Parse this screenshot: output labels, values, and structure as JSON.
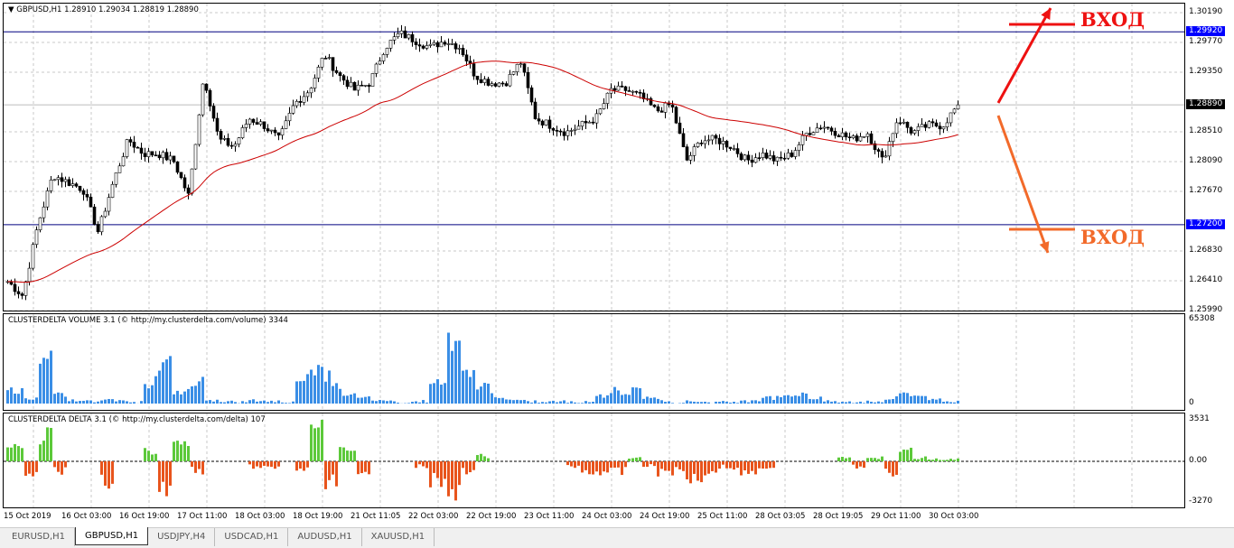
{
  "main": {
    "title": "GBPUSD,H1  1.28910 1.29034 1.28819 1.28890",
    "price_ticks": [
      "1.30190",
      "1.29770",
      "1.29350",
      "1.28510",
      "1.28090",
      "1.27670",
      "1.26830",
      "1.26410",
      "1.25990"
    ],
    "level_high": "1.29920",
    "level_low": "1.27200",
    "current_price": "1.28890",
    "entry_up_label": "ВХОД",
    "entry_down_label": "ВХОД",
    "colors": {
      "level": "#000080",
      "tag": "#0000ff",
      "ma": "#cc0000",
      "up_arrow": "#ee1111",
      "down_arrow": "#f26a2a"
    }
  },
  "volume": {
    "title": "CLUSTERDELTA VOLUME 3.1 (© http://my.clusterdelta.com/volume) 3344",
    "max_label": "65308",
    "zero_label": "0",
    "color": "#3a8ee6"
  },
  "delta": {
    "title": "CLUSTERDELTA DELTA 3.1 (© http://my.clusterdelta.com/delta) 107",
    "max_label": "3531",
    "zero_label": "0.00",
    "min_label": "-3270",
    "pos_color": "#5cc93a",
    "neg_color": "#e8541c"
  },
  "time_labels": [
    "15 Oct 2019",
    "16 Oct 03:00",
    "16 Oct 19:00",
    "17 Oct 11:00",
    "18 Oct 03:00",
    "18 Oct 19:00",
    "21 Oct 11:05",
    "22 Oct 03:00",
    "22 Oct 19:00",
    "23 Oct 11:00",
    "24 Oct 03:00",
    "24 Oct 19:00",
    "25 Oct 11:00",
    "28 Oct 03:05",
    "28 Oct 19:05",
    "29 Oct 11:00",
    "30 Oct 03:00"
  ],
  "tabs": [
    {
      "label": "EURUSD,H1",
      "active": false
    },
    {
      "label": "GBPUSD,H1",
      "active": true
    },
    {
      "label": "USDJPY,H4",
      "active": false
    },
    {
      "label": "USDCAD,H1",
      "active": false
    },
    {
      "label": "AUDUSD,H1",
      "active": false
    },
    {
      "label": "XAUUSD,H1",
      "active": false
    }
  ],
  "chart_data": {
    "type": "candlestick",
    "symbol": "GBPUSD",
    "timeframe": "H1",
    "ylim": [
      1.2599,
      1.3019
    ],
    "close_path": [
      1.264,
      1.262,
      1.272,
      1.279,
      1.278,
      1.277,
      1.271,
      1.278,
      1.284,
      1.282,
      1.282,
      1.281,
      1.276,
      1.293,
      1.284,
      1.283,
      1.287,
      1.286,
      1.284,
      1.289,
      1.291,
      1.296,
      1.293,
      1.291,
      1.292,
      1.297,
      1.299,
      1.298,
      1.297,
      1.298,
      1.297,
      1.293,
      1.292,
      1.292,
      1.295,
      1.287,
      1.286,
      1.285,
      1.286,
      1.287,
      1.291,
      1.291,
      1.29,
      1.288,
      1.289,
      1.281,
      1.284,
      1.284,
      1.283,
      1.281,
      1.282,
      1.281,
      1.282,
      1.285,
      1.286,
      1.285,
      1.284,
      1.285,
      1.281,
      1.287,
      1.285,
      1.286,
      1.286,
      1.2889
    ],
    "volume_profile": [
      12,
      4,
      60,
      8,
      2,
      1,
      4,
      1,
      0,
      25,
      40,
      12,
      22,
      3,
      1,
      0,
      2,
      1,
      0,
      26,
      40,
      30,
      12,
      5,
      2,
      1,
      0,
      1,
      22,
      60,
      30,
      20,
      8,
      2,
      1,
      0,
      1,
      0,
      1,
      8,
      14,
      12,
      6,
      2,
      0,
      1,
      0,
      0,
      1,
      2,
      6,
      8,
      10,
      4,
      1,
      0,
      0,
      1,
      4,
      10,
      8,
      3,
      1,
      2
    ],
    "delta_profile": [
      2,
      -1,
      3,
      -1,
      0,
      0,
      -2,
      0,
      0,
      1,
      -3,
      2,
      -1,
      0,
      0,
      0,
      -0.5,
      -0.5,
      0,
      -1,
      3,
      -2,
      1,
      -1,
      0,
      0,
      0,
      -0.5,
      -2,
      -3,
      -1,
      0.5,
      0,
      0,
      0,
      0,
      0,
      -0.5,
      -1,
      -1,
      -1,
      0.3,
      -0.5,
      -1,
      -1,
      -1.5,
      -1,
      -0.5,
      -1,
      -1,
      -0.5,
      0,
      0,
      0,
      0,
      0.3,
      -0.5,
      0.4,
      -1,
      1,
      0.4,
      0.2,
      0.2,
      0.2
    ]
  }
}
